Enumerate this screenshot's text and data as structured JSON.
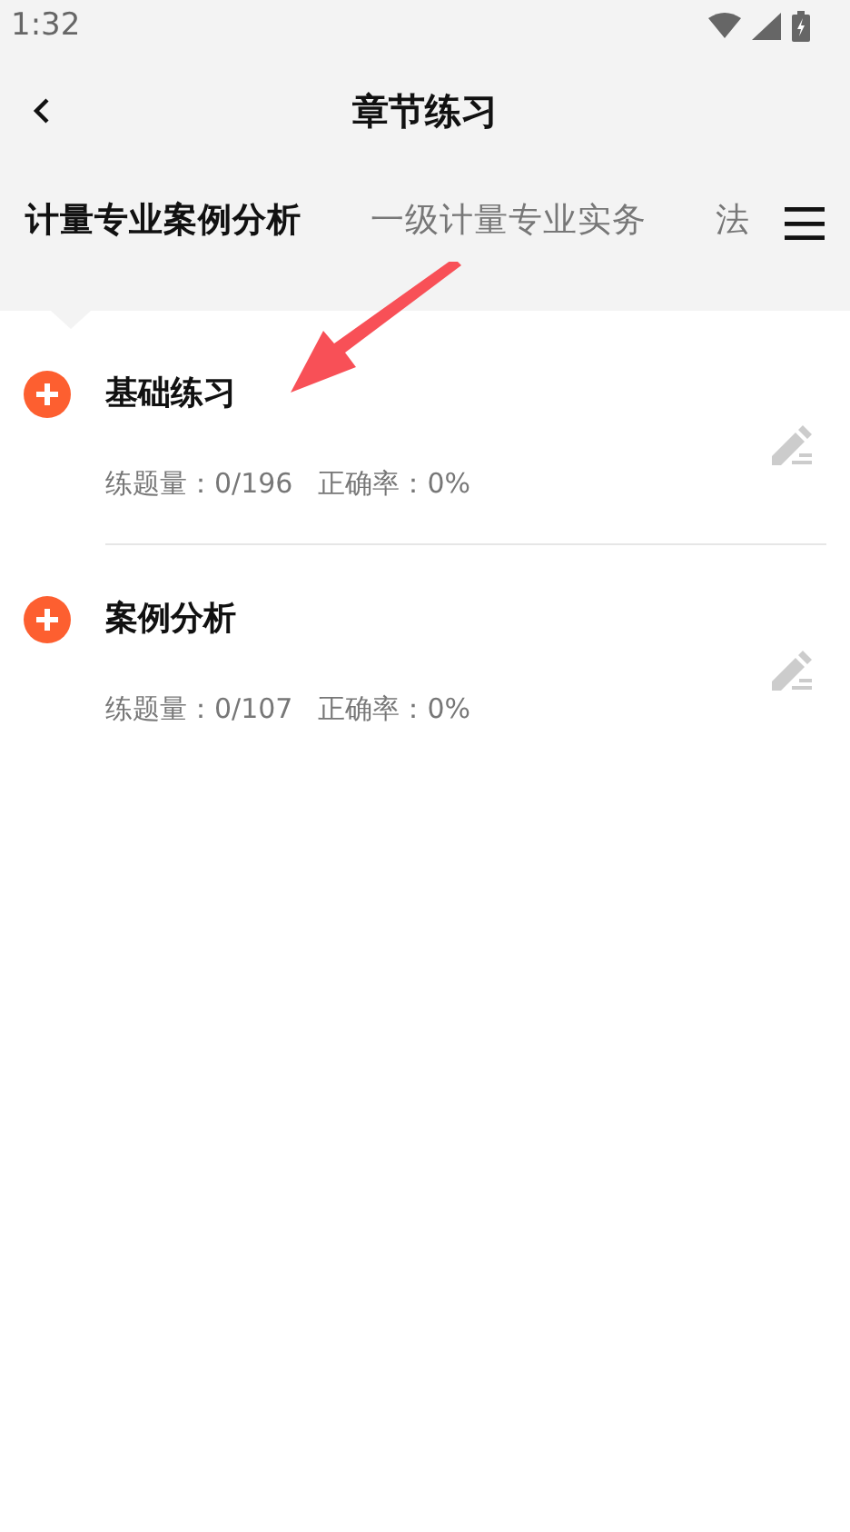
{
  "status_bar": {
    "time": "1:32"
  },
  "header": {
    "title": "章节练习"
  },
  "tabs": [
    {
      "label": "计量专业案例分析",
      "selected": true
    },
    {
      "label": "一级计量专业实务",
      "selected": false
    },
    {
      "label": "法",
      "selected": false
    }
  ],
  "chapters": [
    {
      "title": "基础练习",
      "count": "练题量：0/196",
      "accuracy": "正确率：0%"
    },
    {
      "title": "案例分析",
      "count": "练题量：0/107",
      "accuracy": "正确率：0%"
    }
  ]
}
